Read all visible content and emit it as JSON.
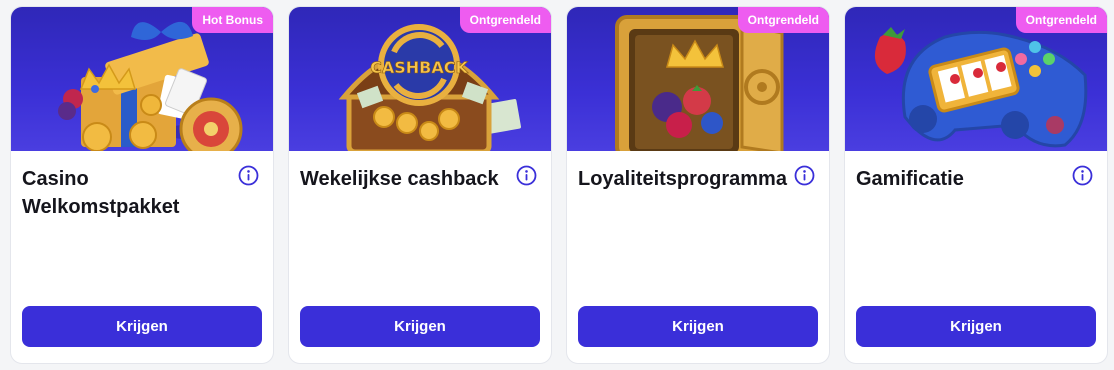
{
  "cards": [
    {
      "badge": "Hot Bonus",
      "title": "Casino Welkomstpakket",
      "button": "Krijgen",
      "art": "gift-box-crown-coins-icon"
    },
    {
      "badge": "Ontgrendeld",
      "title": "Wekelijkse cashback",
      "button": "Krijgen",
      "art": "treasure-chest-cashback-icon",
      "art_text": "CASHBACK"
    },
    {
      "badge": "Ontgrendeld",
      "title": "Loyaliteitsprogramma",
      "button": "Krijgen",
      "art": "safe-crown-berries-icon"
    },
    {
      "badge": "Ontgrendeld",
      "title": "Gamificatie",
      "button": "Krijgen",
      "art": "gamepad-slot-strawberry-icon"
    }
  ],
  "colors": {
    "hero_bg": "#3b30d6",
    "badge_bg": "#ee5cf0",
    "button_bg": "#3a2fd9",
    "info_icon": "#3a2fd9"
  }
}
